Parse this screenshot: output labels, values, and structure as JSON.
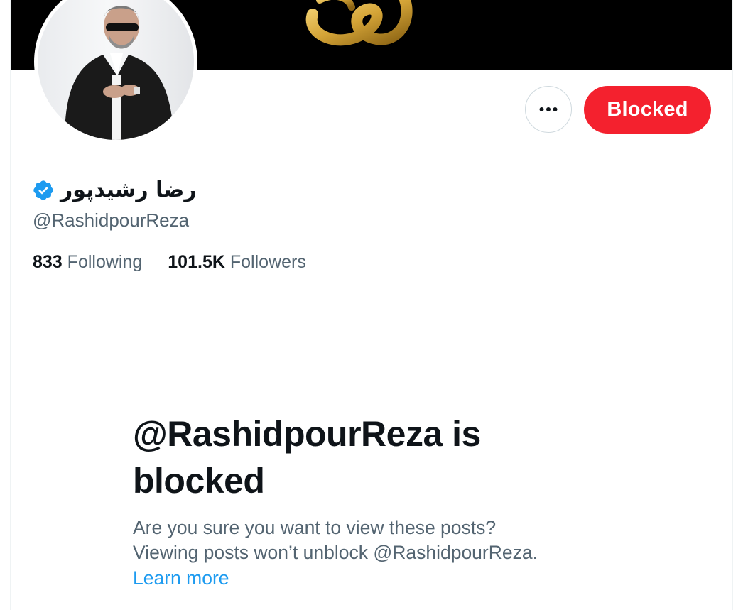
{
  "profile": {
    "display_name": "رضا رشیدپور",
    "handle": "@RashidpourReza",
    "verified": true,
    "following_count": "833",
    "following_label": "Following",
    "followers_count": "101.5K",
    "followers_label": "Followers"
  },
  "actions": {
    "more_icon": "more-horizontal-icon",
    "blocked_label": "Blocked"
  },
  "blocked_notice": {
    "title": "@RashidpourReza is blocked",
    "line1": "Are you sure you want to view these posts?",
    "line2": "Viewing posts won’t unblock @RashidpourReza.",
    "learn_more": "Learn more"
  },
  "colors": {
    "blocked_red": "#f4212e",
    "link_blue": "#1d9bf0",
    "verified_blue": "#1d9bf0",
    "text_primary": "#0f1419",
    "text_secondary": "#536471",
    "banner_bg": "#000000",
    "banner_logo_gold": "#d4a437"
  }
}
